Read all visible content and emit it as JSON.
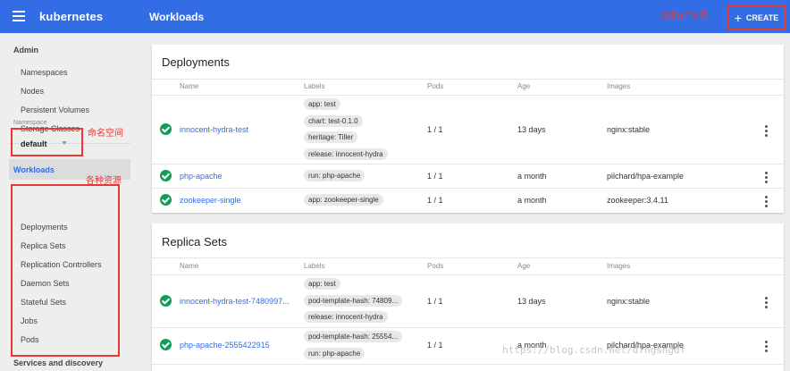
{
  "topbar": {
    "brand": "kubernetes",
    "page_title": "Workloads",
    "annotation": "创建各种资源",
    "create_label": "CREATE",
    "plus": "+"
  },
  "sidebar": {
    "admin_label": "Admin",
    "admin_items": [
      "Namespaces",
      "Nodes",
      "Persistent Volumes",
      "Storage Classes"
    ],
    "namespace_label": "Namespace",
    "namespace_value": "default",
    "namespace_annotation": "命名空间",
    "workloads_label": "Workloads",
    "workloads_annotation": "各种资源",
    "workload_items": [
      "Deployments",
      "Replica Sets",
      "Replication Controllers",
      "Daemon Sets",
      "Stateful Sets",
      "Jobs",
      "Pods"
    ],
    "services_label": "Services and discovery"
  },
  "columns": [
    "Name",
    "Labels",
    "Pods",
    "Age",
    "Images"
  ],
  "deployments": {
    "title": "Deployments",
    "rows": [
      {
        "name": "innocent-hydra-test",
        "labels": [
          "app: test",
          "chart: test-0.1.0",
          "heritage: Tiller",
          "release: innocent-hydra"
        ],
        "pods": "1 / 1",
        "age": "13 days",
        "image": "nginx:stable"
      },
      {
        "name": "php-apache",
        "labels": [
          "run: php-apache"
        ],
        "pods": "1 / 1",
        "age": "a month",
        "image": "pilchard/hpa-example"
      },
      {
        "name": "zookeeper-single",
        "labels": [
          "app: zookeeper-single"
        ],
        "pods": "1 / 1",
        "age": "a month",
        "image": "zookeeper:3.4.11"
      }
    ]
  },
  "replica_sets": {
    "title": "Replica Sets",
    "rows": [
      {
        "name": "innocent-hydra-test-7480997...",
        "labels": [
          "app: test",
          "pod-template-hash: 74809...",
          "release: innocent-hydra"
        ],
        "pods": "1 / 1",
        "age": "13 days",
        "image": "nginx:stable"
      },
      {
        "name": "php-apache-2555422915",
        "labels": [
          "pod-template-hash: 25554...",
          "run: php-apache"
        ],
        "pods": "1 / 1",
        "age": "a month",
        "image": "pilchard/hpa-example"
      }
    ]
  },
  "watermark": "https://blog.csdn.net/dfhgshgdf",
  "colors": {
    "topbar": "#326de6",
    "annotation": "#e53935",
    "ok": "#0f9d58",
    "link": "#326de6"
  }
}
